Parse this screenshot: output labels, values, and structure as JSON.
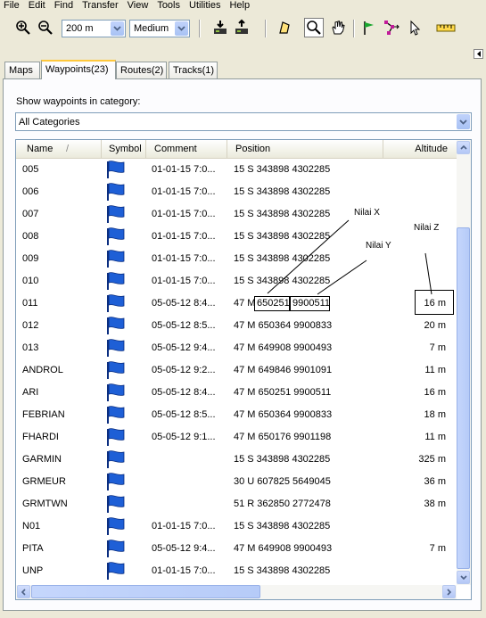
{
  "menu": [
    "File",
    "Edit",
    "Find",
    "Transfer",
    "View",
    "Tools",
    "Utilities",
    "Help"
  ],
  "toolbar": {
    "zoom_value": "200 m",
    "detail_value": "Medium",
    "icons": [
      "zoom-in-icon",
      "zoom-out-icon",
      "receive-from-device-icon",
      "send-to-device-icon",
      "selection-tool-icon",
      "zoom-tool-icon",
      "pan-hand-icon",
      "waypoint-flag-icon",
      "route-tool-icon",
      "pointer-icon",
      "measure-icon"
    ]
  },
  "tabs": [
    {
      "label": "Maps"
    },
    {
      "label": "Waypoints(23)"
    },
    {
      "label": "Routes(2)"
    },
    {
      "label": "Tracks(1)"
    }
  ],
  "category": {
    "label": "Show waypoints in category:",
    "value": "All Categories"
  },
  "table": {
    "columns": [
      "Name",
      "Symbol",
      "Comment",
      "Position",
      "Altitude"
    ],
    "sort_indicator": "/",
    "symbol_color": "#1e5fd6",
    "rows": [
      {
        "name": "005",
        "comment": "01-01-15 7:0...",
        "position": "15 S 343898 4302285",
        "altitude": ""
      },
      {
        "name": "006",
        "comment": "01-01-15 7:0...",
        "position": "15 S 343898 4302285",
        "altitude": ""
      },
      {
        "name": "007",
        "comment": "01-01-15 7:0...",
        "position": "15 S 343898 4302285",
        "altitude": ""
      },
      {
        "name": "008",
        "comment": "01-01-15 7:0...",
        "position": "15 S 343898 4302285",
        "altitude": ""
      },
      {
        "name": "009",
        "comment": "01-01-15 7:0...",
        "position": "15 S 343898 4302285",
        "altitude": ""
      },
      {
        "name": "010",
        "comment": "01-01-15 7:0...",
        "position": "15 S 343898 4302285",
        "altitude": ""
      },
      {
        "name": "011",
        "comment": "05-05-12 8:4...",
        "position_zone": "47 M",
        "position_x": "650251",
        "position_y": "9900511",
        "altitude": "16 m"
      },
      {
        "name": "012",
        "comment": "05-05-12 8:5...",
        "position": "47 M 650364 9900833",
        "altitude": "20 m"
      },
      {
        "name": "013",
        "comment": "05-05-12 9:4...",
        "position": "47 M 649908 9900493",
        "altitude": "7 m"
      },
      {
        "name": "ANDROL",
        "comment": "05-05-12 9:2...",
        "position": "47 M 649846 9901091",
        "altitude": "11 m"
      },
      {
        "name": "ARI",
        "comment": "05-05-12 8:4...",
        "position": "47 M 650251 9900511",
        "altitude": "16 m"
      },
      {
        "name": "FEBRIAN",
        "comment": "05-05-12 8:5...",
        "position": "47 M 650364 9900833",
        "altitude": "18 m"
      },
      {
        "name": "FHARDI",
        "comment": "05-05-12 9:1...",
        "position": "47 M 650176 9901198",
        "altitude": "11 m"
      },
      {
        "name": "GARMIN",
        "comment": "",
        "position": "15 S 343898 4302285",
        "altitude": "325 m"
      },
      {
        "name": "GRMEUR",
        "comment": "",
        "position": "30 U 607825 5649045",
        "altitude": "36 m"
      },
      {
        "name": "GRMTWN",
        "comment": "",
        "position": "51 R 362850 2772478",
        "altitude": "38 m"
      },
      {
        "name": "N01",
        "comment": "01-01-15 7:0...",
        "position": "15 S 343898 4302285",
        "altitude": ""
      },
      {
        "name": "PITA",
        "comment": "05-05-12 9:4...",
        "position": "47 M 649908 9900493",
        "altitude": "7 m"
      },
      {
        "name": "UNP",
        "comment": "01-01-15 7:0...",
        "position": "15 S 343898 4302285",
        "altitude": ""
      }
    ]
  },
  "annotations": {
    "x": "Nilai X",
    "y": "Nilai Y",
    "z": "Nilai Z"
  }
}
